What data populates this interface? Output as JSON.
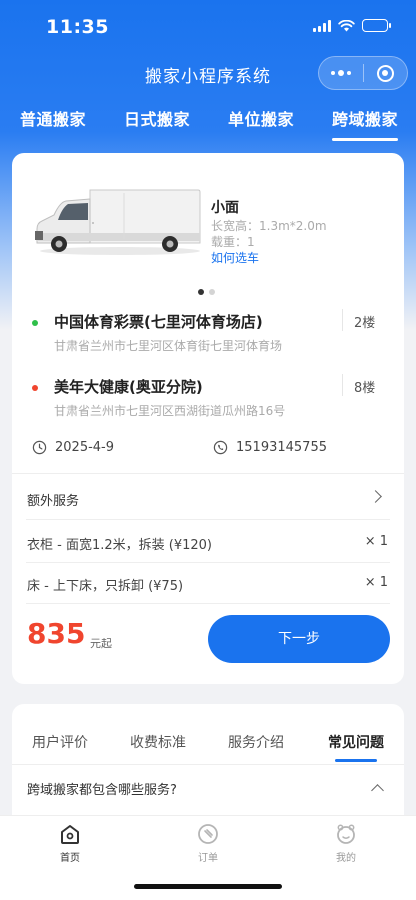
{
  "status_bar": {
    "time": "11:35"
  },
  "nav": {
    "title": "搬家小程序系统"
  },
  "top_tabs": [
    {
      "label": "普通搬家",
      "active": false
    },
    {
      "label": "日式搬家",
      "active": false
    },
    {
      "label": "单位搬家",
      "active": false
    },
    {
      "label": "跨域搬家",
      "active": true
    }
  ],
  "vehicle": {
    "name": "小面",
    "dimensions": "长宽高：1.3m*2.0m",
    "load": "载重：1",
    "choose_link": "如何选车",
    "carousel_count": 2,
    "carousel_active": 0
  },
  "addresses": [
    {
      "name": "中国体育彩票(七里河体育场店)",
      "detail": "甘肃省兰州市七里河区体育街七里河体育场",
      "floor": "2楼",
      "dot_color": "#2fbf4a"
    },
    {
      "name": "美年大健康(奥亚分院)",
      "detail": "甘肃省兰州市七里河区西湖街道瓜州路16号",
      "floor": "8楼",
      "dot_color": "#f0452e"
    }
  ],
  "schedule": {
    "date": "2025-4-9",
    "phone": "15193145755"
  },
  "extra_services": {
    "title": "额外服务",
    "items": [
      {
        "label": "衣柜 - 面宽1.2米，拆装 (¥120)",
        "qty": "× 1"
      },
      {
        "label": "床 - 上下床，只拆卸 (¥75)",
        "qty": "× 1"
      }
    ]
  },
  "price": {
    "amount": "835",
    "unit": "元起"
  },
  "next_button": "下一步",
  "info_tabs": [
    {
      "label": "用户评价",
      "active": false
    },
    {
      "label": "收费标准",
      "active": false
    },
    {
      "label": "服务介绍",
      "active": false
    },
    {
      "label": "常见问题",
      "active": true
    }
  ],
  "faq": {
    "question": "跨域搬家都包含哪些服务?"
  },
  "tabbar": [
    {
      "label": "首页",
      "icon": "home-icon",
      "active": true
    },
    {
      "label": "订单",
      "icon": "order-icon",
      "active": false
    },
    {
      "label": "我的",
      "icon": "profile-icon",
      "active": false
    }
  ],
  "colors": {
    "accent": "#1a73ee",
    "price": "#f0452e"
  }
}
